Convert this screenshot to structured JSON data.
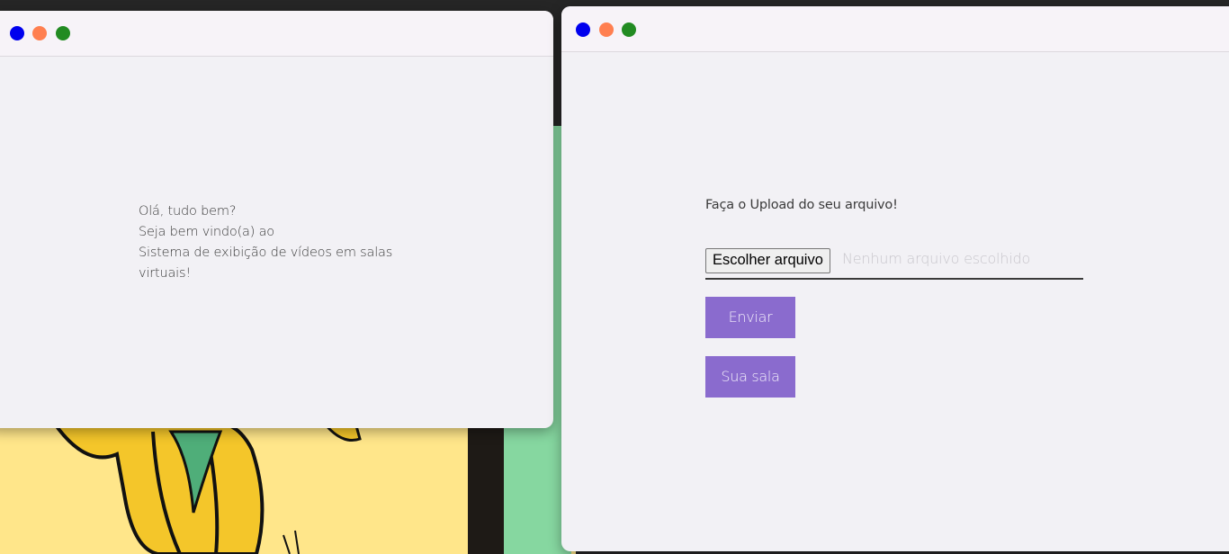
{
  "desktop": {
    "colors": {
      "background": "#262626",
      "green": "#86d7a0",
      "yellow": "#ffe68a",
      "banana": "#f4c62a",
      "leaf": "#4fae79",
      "outline": "#111111"
    }
  },
  "windows": [
    {
      "id": "welcome",
      "controls": [
        {
          "name": "blue",
          "color": "#0000ee"
        },
        {
          "name": "orange",
          "color": "#ff7f50"
        },
        {
          "name": "green",
          "color": "#228b22"
        }
      ],
      "lines": [
        "Olá, tudo bem?",
        "Seja bem vindo(a) ao",
        "Sistema de exibição de vídeos em salas virtuais!"
      ]
    },
    {
      "id": "upload",
      "controls": [
        {
          "name": "blue",
          "color": "#0000ee"
        },
        {
          "name": "orange",
          "color": "#ff7f50"
        },
        {
          "name": "green",
          "color": "#228b22"
        }
      ],
      "title": "Faça o Upload do seu arquivo!",
      "file_input": {
        "button_label": "Escolher arquivo",
        "status": "Nenhum arquivo escolhido"
      },
      "buttons": {
        "send": "Enviar",
        "room": "Sua sala"
      },
      "accent": "#8a6bce"
    }
  ]
}
